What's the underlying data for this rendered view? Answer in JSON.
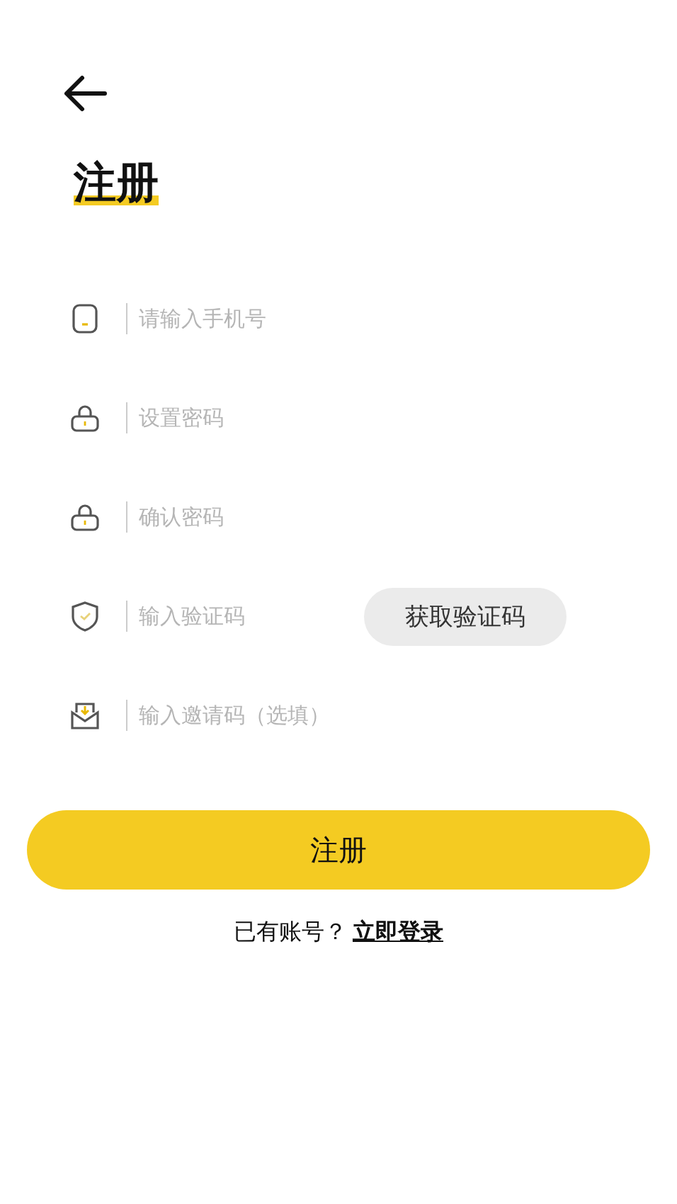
{
  "title": "注册",
  "fields": [
    {
      "kind": "phone",
      "placeholder": "请输入手机号"
    },
    {
      "kind": "lock",
      "placeholder": "设置密码"
    },
    {
      "kind": "lock",
      "placeholder": "确认密码"
    },
    {
      "kind": "shield",
      "placeholder": "输入验证码",
      "action": "获取验证码"
    },
    {
      "kind": "mail",
      "placeholder": "输入邀请码（选填）"
    }
  ],
  "submit": "注册",
  "footer": {
    "text": "已有账号？",
    "link": "立即登录"
  }
}
